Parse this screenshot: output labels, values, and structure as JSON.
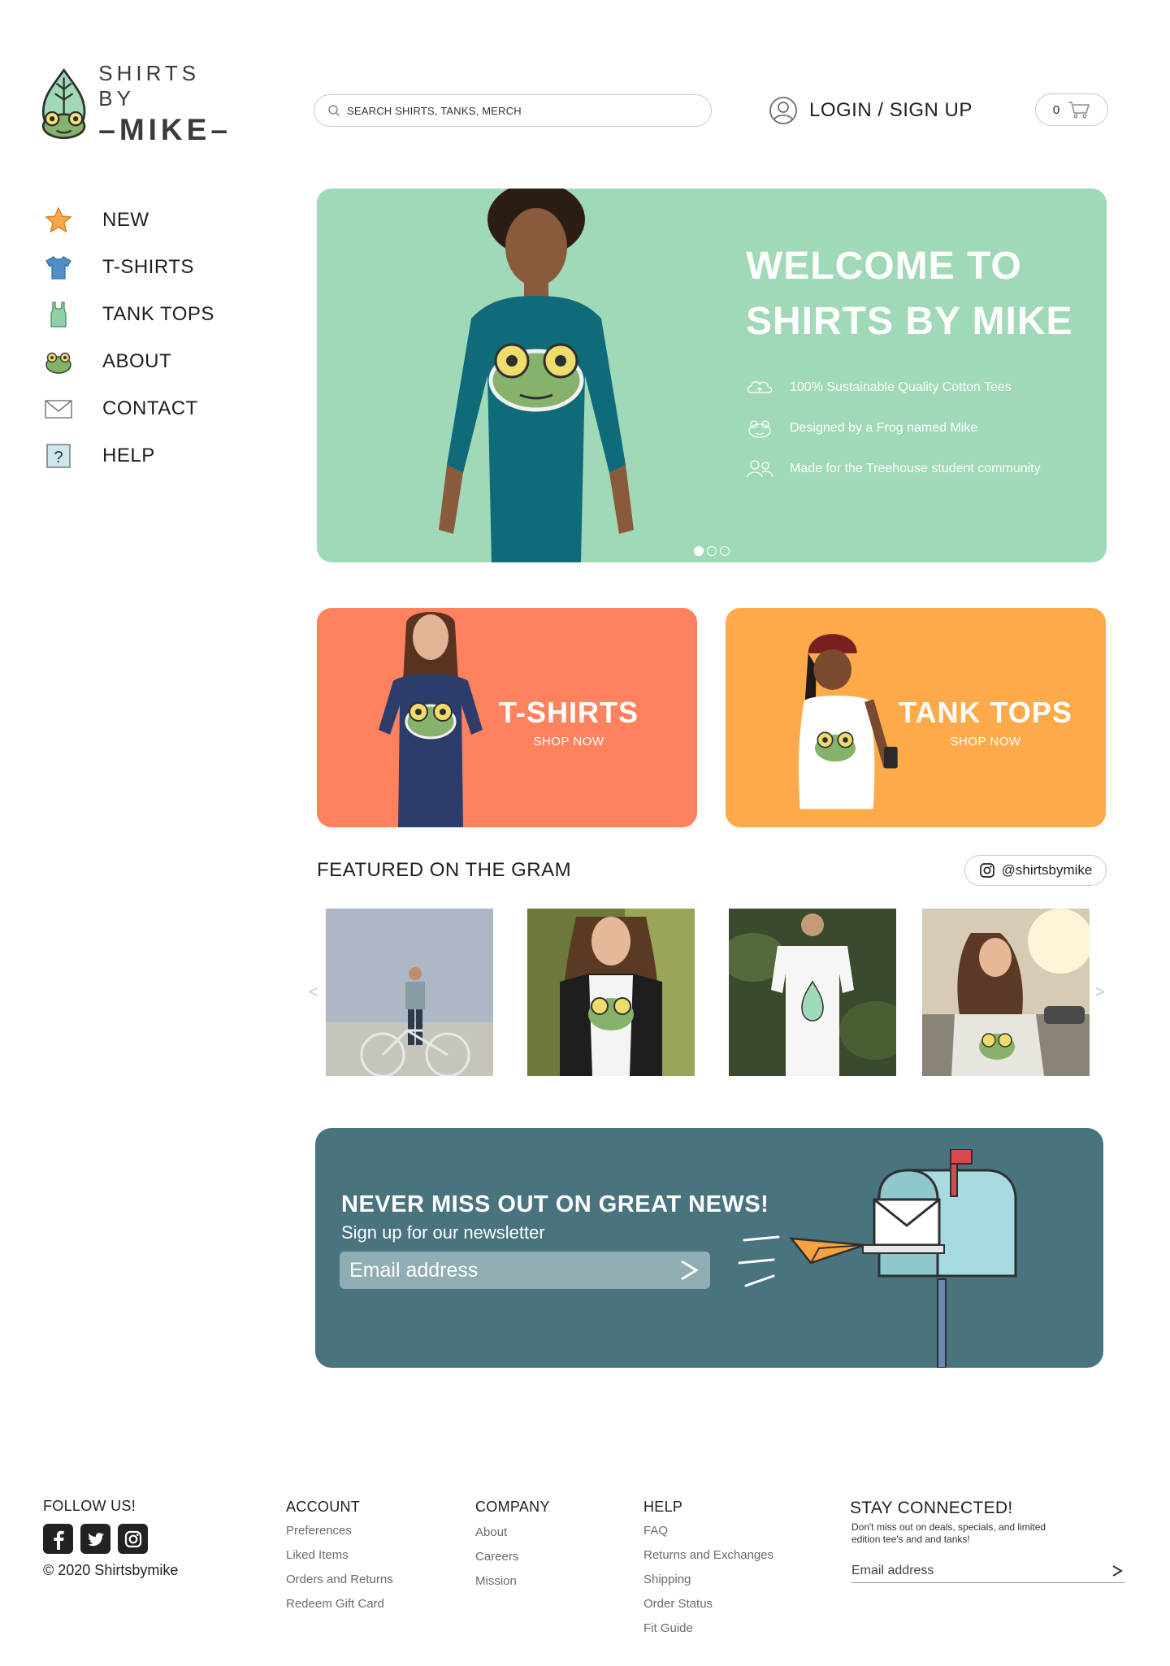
{
  "brand": {
    "name_top": "SHIRTS BY",
    "name_bottom": "–MIKE–",
    "color_green": "#a0d9b7"
  },
  "header": {
    "search_placeholder": "SEARCH SHIRTS, TANKS, MERCH",
    "login_label": "LOGIN / SIGN UP",
    "cart_count": "0"
  },
  "sidebar": {
    "items": [
      {
        "label": "NEW",
        "icon": "star-icon"
      },
      {
        "label": "T-SHIRTS",
        "icon": "tshirt-icon"
      },
      {
        "label": "TANK TOPS",
        "icon": "tank-top-icon"
      },
      {
        "label": "ABOUT",
        "icon": "frog-icon"
      },
      {
        "label": "CONTACT",
        "icon": "envelope-icon"
      },
      {
        "label": "HELP",
        "icon": "help-icon"
      }
    ]
  },
  "hero": {
    "title_line1": "WELCOME TO",
    "title_line2": "SHIRTS BY MIKE",
    "features": [
      "100% Sustainable Quality Cotton Tees",
      "Designed by a Frog named Mike",
      "Made for the Treehouse student community"
    ],
    "slide_active": 1,
    "slide_count": 3
  },
  "categories": [
    {
      "title": "T-SHIRTS",
      "cta": "SHOP NOW",
      "color": "#fe825d"
    },
    {
      "title": "TANK TOPS",
      "cta": "SHOP NOW",
      "color": "#feaa4b"
    }
  ],
  "featured": {
    "title": "FEATURED ON THE GRAM",
    "handle": "@shirtsbymike",
    "prev_arrow": "<",
    "next_arrow": ">"
  },
  "newsletter": {
    "title": "NEVER MISS OUT ON GREAT NEWS!",
    "subtitle": "Sign up for our newsletter",
    "input_placeholder": "Email address",
    "color": "#48737f"
  },
  "footer": {
    "follow_title": "FOLLOW US!",
    "copyright": "© 2020 Shirtsbymike",
    "account": {
      "title": "ACCOUNT",
      "links": [
        "Preferences",
        "Liked Items",
        "Orders and Returns",
        "Redeem Gift Card"
      ]
    },
    "company": {
      "title": "COMPANY",
      "links": [
        "About",
        "Careers",
        "Mission"
      ]
    },
    "help": {
      "title": "HELP",
      "links": [
        "FAQ",
        "Returns and Exchanges",
        "Shipping",
        "Order Status",
        "Fit Guide"
      ]
    },
    "stay": {
      "title": "STAY CONNECTED!",
      "description": "Don't miss out on deals, specials, and limited edition tee's and and tanks!",
      "input_placeholder": "Email address"
    }
  }
}
